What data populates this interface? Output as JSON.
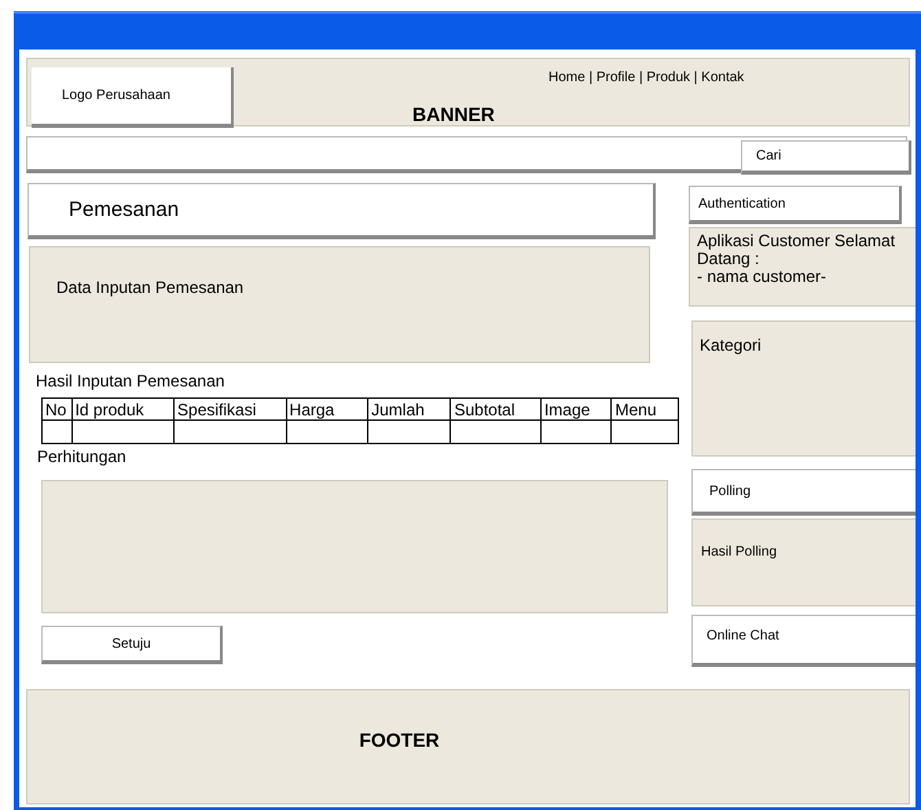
{
  "header": {
    "logo": "Logo Perusahaan",
    "nav": "Home | Profile | Produk | Kontak",
    "banner": "BANNER"
  },
  "search_bar": {
    "button": "Cari"
  },
  "main": {
    "title": "Pemesanan",
    "input_panel": "Data Inputan Pemesanan",
    "results_label": "Hasil Inputan Pemesanan",
    "table": {
      "columns": [
        "No",
        "Id produk",
        "Spesifikasi",
        "Harga",
        "Jumlah",
        "Subtotal",
        "Image",
        "Menu"
      ]
    },
    "calculation_label": "Perhitungan",
    "submit_button": "Setuju"
  },
  "sidebar": [
    {
      "kind": "button",
      "label": "Authentication"
    },
    {
      "kind": "panel",
      "lines": [
        "Aplikasi Customer Selamat Datang :",
        "- nama customer-"
      ]
    },
    {
      "kind": "panel",
      "lines": [
        "Kategori"
      ]
    },
    {
      "kind": "button",
      "label": "Polling"
    },
    {
      "kind": "panel",
      "lines": [
        "Hasil Polling"
      ]
    },
    {
      "kind": "button",
      "label": "Online Chat"
    }
  ],
  "footer": "FOOTER"
}
